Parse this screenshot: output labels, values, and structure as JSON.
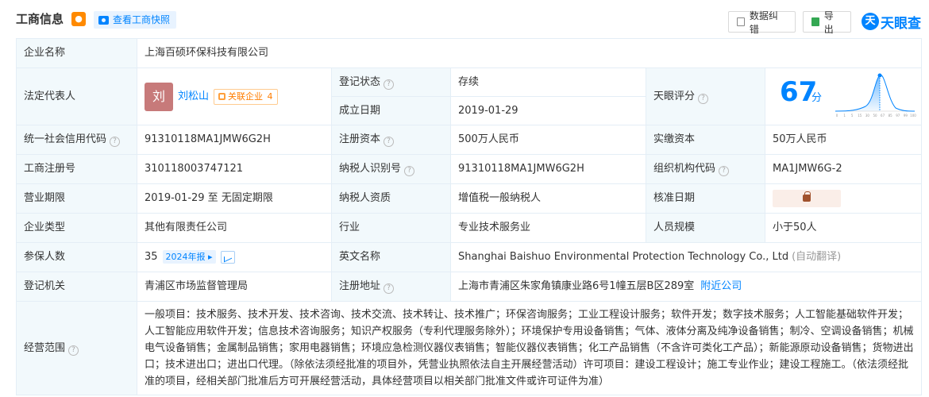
{
  "header": {
    "title": "工商信息",
    "snapshot_label": "查看工商快照",
    "correct_label": "数据纠错",
    "export_label": "导出",
    "logo_mark": "天",
    "logo_text": "天眼查"
  },
  "labels": {
    "company_name": "企业名称",
    "legal_rep": "法定代表人",
    "reg_status": "登记状态",
    "est_date": "成立日期",
    "tianyan_score": "天眼评分",
    "credit_code": "统一社会信用代码",
    "reg_capital": "注册资本",
    "paid_capital": "实缴资本",
    "biz_reg_no": "工商注册号",
    "taxpayer_id": "纳税人识别号",
    "org_code": "组织机构代码",
    "biz_term": "营业期限",
    "taxpayer_qual": "纳税人资质",
    "approval_date": "核准日期",
    "company_type": "企业类型",
    "industry": "行业",
    "staff_size": "人员规模",
    "insured_count": "参保人数",
    "english_name": "英文名称",
    "reg_authority": "登记机关",
    "reg_address": "注册地址",
    "biz_scope": "经营范围"
  },
  "values": {
    "company_name": "上海百硕环保科技有限公司",
    "legal_rep_avatar": "刘",
    "legal_rep_name": "刘松山",
    "related_label": "关联企业",
    "related_count": "4",
    "reg_status": "存续",
    "est_date": "2019-01-29",
    "score": "67",
    "score_unit": "分",
    "credit_code": "91310118MA1JMW6G2H",
    "reg_capital": "500万人民币",
    "paid_capital": "50万人民币",
    "biz_reg_no": "310118003747121",
    "taxpayer_id": "91310118MA1JMW6G2H",
    "org_code": "MA1JMW6G-2",
    "biz_term": "2019-01-29 至 无固定期限",
    "taxpayer_qual": "增值税一般纳税人",
    "company_type": "其他有限责任公司",
    "industry": "专业技术服务业",
    "staff_size": "小于50人",
    "insured_count": "35",
    "report_tag": "2024年报",
    "english_name": "Shanghai Baishuo Environmental Protection Technology Co., Ltd",
    "auto_translate": "(自动翻译)",
    "reg_authority": "青浦区市场监督管理局",
    "reg_address": "上海市青浦区朱家角镇康业路6号1幢五层B区289室",
    "nearby_label": "附近公司",
    "biz_scope": "一般项目：技术服务、技术开发、技术咨询、技术交流、技术转让、技术推广；环保咨询服务；工业工程设计服务；软件开发；数字技术服务；人工智能基础软件开发；人工智能应用软件开发；信息技术咨询服务；知识产权服务（专利代理服务除外）；环境保护专用设备销售；气体、液体分离及纯净设备销售；制冷、空调设备销售；机械电气设备销售；金属制品销售；家用电器销售；环境应急检测仪器仪表销售；智能仪器仪表销售；化工产品销售（不含许可类化工产品）；新能源原动设备销售；货物进出口；技术进出口；进出口代理。（除依法须经批准的项目外，凭营业执照依法自主开展经营活动）许可项目：建设工程设计；施工专业作业；建设工程施工。（依法须经批准的项目，经相关部门批准后方可开展经营活动，具体经营项目以相关部门批准文件或许可证件为准）"
  },
  "score_chart": {
    "ticks": [
      "0",
      "1",
      "5",
      "15",
      "30",
      "50",
      "67",
      "85",
      "97",
      "99",
      "100"
    ],
    "accent": "#0084ff"
  },
  "colors": {
    "accent": "#0084ff",
    "status_ok": "#17a95f",
    "label_bg": "#f2f9fc",
    "border": "#e4eef6",
    "tag_orange": "#ff7d00"
  }
}
